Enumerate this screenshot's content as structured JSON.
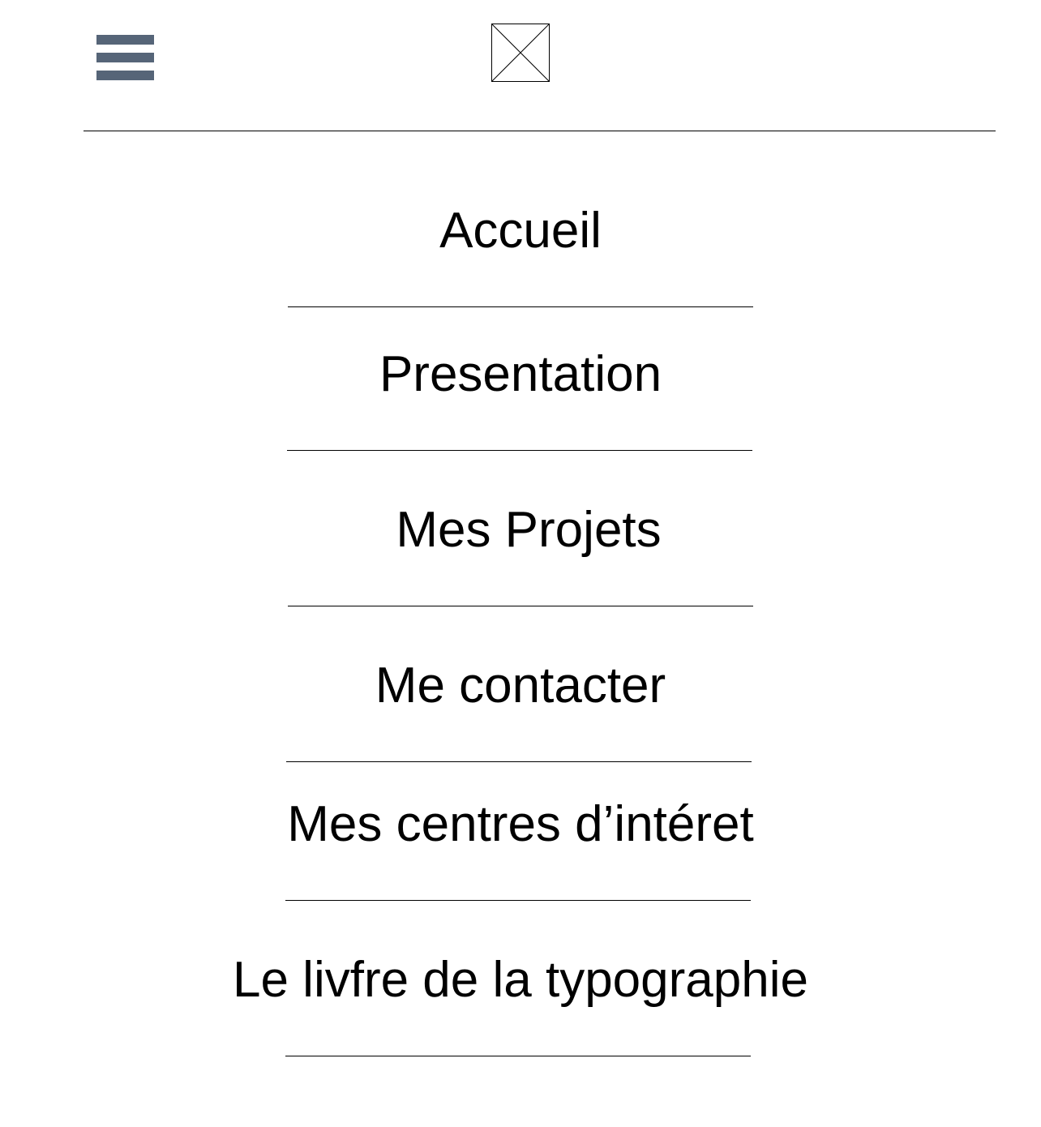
{
  "header": {
    "menu_icon": "hamburger-menu-icon",
    "logo_icon": "image-placeholder-icon",
    "colors": {
      "menu_icon": "#566578",
      "rule": "#000000",
      "text": "#000000",
      "background": "#ffffff"
    }
  },
  "nav": {
    "items": [
      {
        "label": "Accueil"
      },
      {
        "label": "Presentation"
      },
      {
        "label": "Mes Projets"
      },
      {
        "label": "Me contacter"
      },
      {
        "label": "Mes centres d’intéret"
      },
      {
        "label": "Le livfre de la typographie"
      }
    ]
  }
}
